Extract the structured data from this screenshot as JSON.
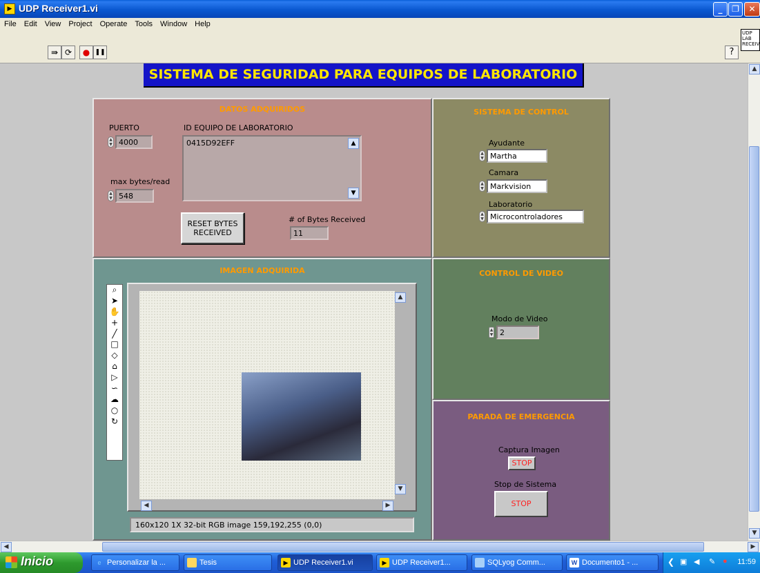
{
  "window": {
    "title": "UDP Receiver1.vi"
  },
  "menu": [
    "File",
    "Edit",
    "View",
    "Project",
    "Operate",
    "Tools",
    "Window",
    "Help"
  ],
  "toolbar": {
    "run": "⇛",
    "continuous": "⟳",
    "abort": "●",
    "pause": "❚❚",
    "help": "?"
  },
  "vi_icon_text": "UDP LAB RECEIVE",
  "panel": {
    "main_title": "SISTEMA DE SEGURIDAD PARA EQUIPOS DE LABORATORIO",
    "datos": {
      "title": "DATOS ADQUIRIDOS",
      "puerto_label": "PUERTO",
      "puerto_value": "4000",
      "max_bytes_label": "max bytes/read",
      "max_bytes_value": "548",
      "id_label": "ID EQUIPO DE LABORATORIO",
      "id_value": "0415D92EFF",
      "reset_label": "RESET BYTES RECEIVED",
      "bytes_received_label": "# of Bytes Received",
      "bytes_received_value": "11"
    },
    "control": {
      "title": "SISTEMA DE CONTROL",
      "ayudante_label": "Ayudante",
      "ayudante_value": "Martha",
      "camara_label": "Camara",
      "camara_value": "Markvision",
      "laboratorio_label": "Laboratorio",
      "laboratorio_value": "Microcontroladores"
    },
    "imagen": {
      "title": "IMAGEN ADQUIRIDA",
      "status": "160x120 1X 32-bit RGB image 159,192,255    (0,0)"
    },
    "video": {
      "title": "CONTROL DE VIDEO",
      "modo_label": "Modo de Video",
      "modo_value": "2"
    },
    "emergencia": {
      "title": "PARADA DE EMERGENCIA",
      "captura_label": "Captura Imagen",
      "captura_button": "STOP",
      "stop_sistema_label": "Stop de Sistema",
      "stop_sistema_button": "STOP"
    }
  },
  "taskbar": {
    "start": "Inicio",
    "tasks": [
      {
        "label": "Personalizar la ...",
        "icon": "ie-icon"
      },
      {
        "label": "Tesis",
        "icon": "folder-icon"
      },
      {
        "label": "UDP Receiver1.vi",
        "icon": "labview-icon"
      },
      {
        "label": "UDP Receiver1...",
        "icon": "labview-icon"
      },
      {
        "label": "SQLyog Comm...",
        "icon": "sqlyog-icon"
      },
      {
        "label": "Documento1 - ...",
        "icon": "word-icon"
      }
    ],
    "clock": "11:59"
  },
  "colors": {
    "datos_bg": "#b98c8c",
    "control_bg": "#8c8a64",
    "imagen_bg": "#6f9690",
    "video_bg": "#62805e",
    "emergencia_bg": "#7a5c80",
    "section_title": "#ff9a00",
    "main_title_bg": "#1414c8",
    "main_title_fg": "#ffe600"
  }
}
